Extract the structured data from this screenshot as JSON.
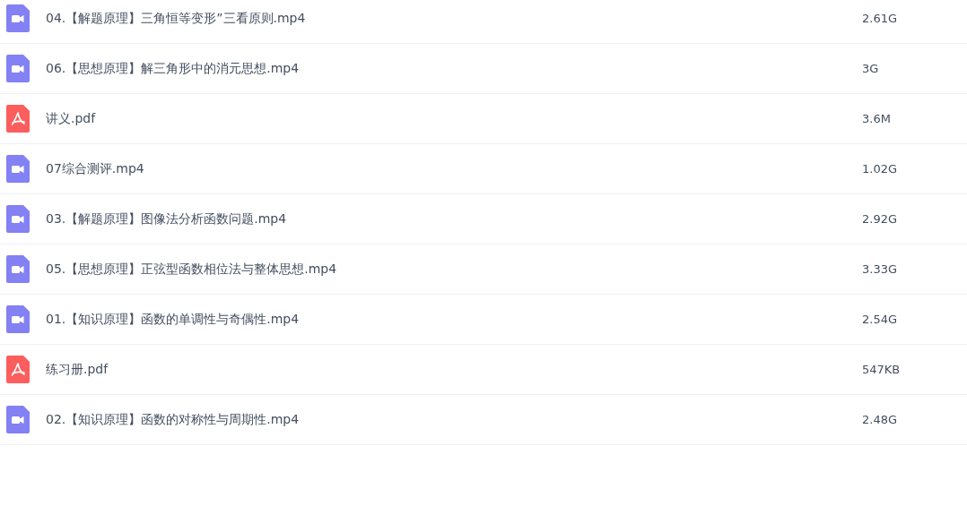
{
  "files": [
    {
      "kind": "video",
      "name": "04.【解题原理】三角恒等变形”三看原则.mp4",
      "size": "2.61G"
    },
    {
      "kind": "video",
      "name": "06.【思想原理】解三角形中的消元思想.mp4",
      "size": "3G"
    },
    {
      "kind": "pdf",
      "name": "讲义.pdf",
      "size": "3.6M"
    },
    {
      "kind": "video",
      "name": "07综合测评.mp4",
      "size": "1.02G"
    },
    {
      "kind": "video",
      "name": "03.【解题原理】图像法分析函数问题.mp4",
      "size": "2.92G"
    },
    {
      "kind": "video",
      "name": "05.【思想原理】正弦型函数相位法与整体思想.mp4",
      "size": "3.33G"
    },
    {
      "kind": "video",
      "name": "01.【知识原理】函数的单调性与奇偶性.mp4",
      "size": "2.54G"
    },
    {
      "kind": "pdf",
      "name": "练习册.pdf",
      "size": "547KB"
    },
    {
      "kind": "video",
      "name": "02.【知识原理】函数的对称性与周期性.mp4",
      "size": "2.48G"
    }
  ]
}
